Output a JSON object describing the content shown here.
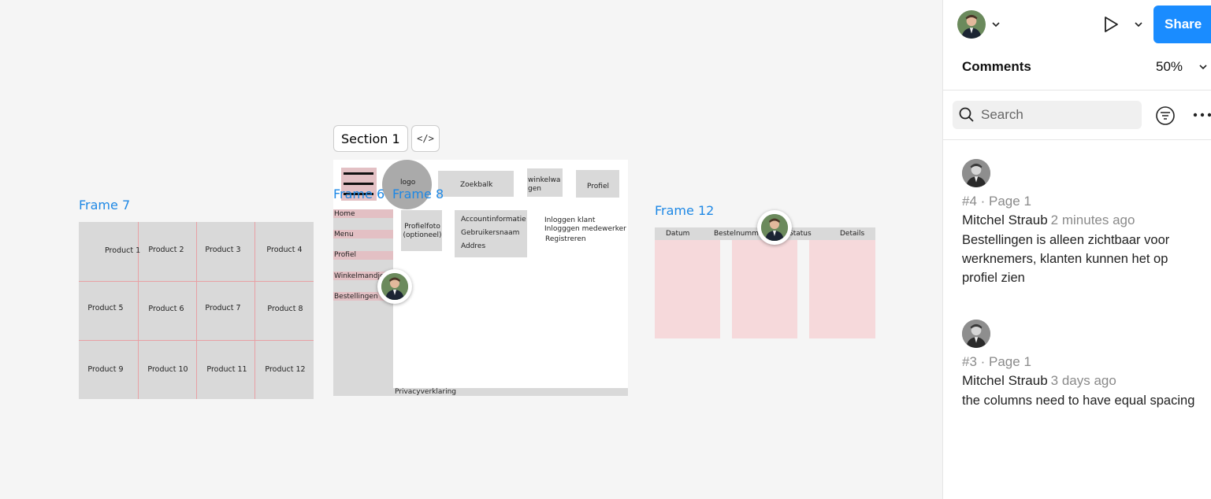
{
  "canvas": {
    "frame7": {
      "label": "Frame 7",
      "products": [
        "Product 1",
        "Product 2",
        "Product 3",
        "Product 4",
        "Product 5",
        "Product 6",
        "Product 7",
        "Product 8",
        "Product 9",
        "Product 10",
        "Product 11",
        "Product 12"
      ]
    },
    "section": {
      "label": "Section 1",
      "code_label": "</>"
    },
    "frame6_label": "Frame 6",
    "frame8": {
      "label": "Frame 8",
      "logo": "logo",
      "search_box": "Zoekbalk",
      "cart_box": "winkelwa gen",
      "profile_box": "Profiel",
      "nav": [
        "Home",
        "Menu",
        "Profiel",
        "Winkelmandje",
        "Bestellingen"
      ],
      "profile_photo": "Profielfoto (optioneel)",
      "account_info": [
        "Accountinformatie",
        "Gebruikersnaam",
        "Addres"
      ],
      "login_links": [
        "Inloggen klant",
        "Inlogggen medewerker",
        "Registreren"
      ],
      "footer": "Privacyverklaring"
    },
    "frame12": {
      "label": "Frame 12",
      "columns": [
        "Datum",
        "Bestelnummer",
        "Status",
        "Details"
      ]
    }
  },
  "panel": {
    "share_label": "Share",
    "title": "Comments",
    "zoom": "50%",
    "search_placeholder": "Search",
    "comments": [
      {
        "meta": "#4 · Page 1",
        "author": "Mitchel Straub",
        "time": "2 minutes ago",
        "body": "Bestellingen is alleen zichtbaar voor werknemers, klanten kunnen het op profiel zien"
      },
      {
        "meta": "#3 · Page 1",
        "author": "Mitchel Straub",
        "time": "3 days ago",
        "body": "the columns need to have equal spacing"
      }
    ]
  },
  "colors": {
    "accent": "#1a8cff",
    "frame_label": "#1e88e5",
    "wire_gray": "#d9d9d9",
    "wire_pink": "#f6d9db"
  },
  "icons": [
    "avatar",
    "chevron-down-icon",
    "play-icon",
    "search-icon",
    "filter-icon",
    "more-icon",
    "code-icon"
  ]
}
